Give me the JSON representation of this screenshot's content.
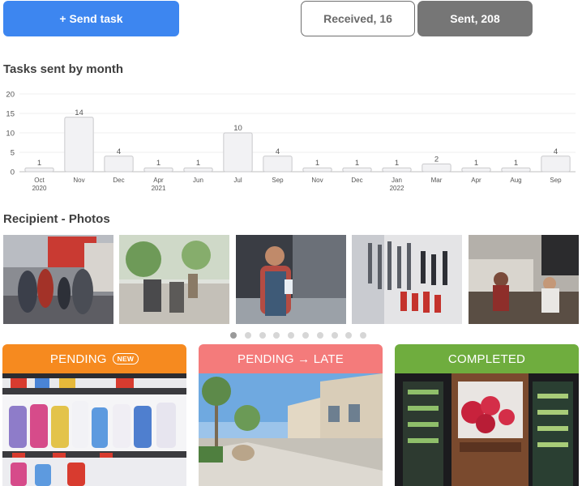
{
  "header": {
    "send_label": "+ Send task",
    "received_label": "Received, 16",
    "sent_label": "Sent, 208"
  },
  "chart_section": {
    "title": "Tasks sent by month"
  },
  "chart_data": {
    "type": "bar",
    "title": "Tasks sent by month",
    "categories": [
      "Oct 2020",
      "Nov",
      "Dec",
      "Apr 2021",
      "Jun",
      "Jul",
      "Sep",
      "Nov",
      "Dec",
      "Jan 2022",
      "Mar",
      "Apr",
      "Aug",
      "Sep"
    ],
    "tick_labels": [
      [
        "Oct",
        "2020"
      ],
      [
        "Nov"
      ],
      [
        "Dec"
      ],
      [
        "Apr",
        "2021"
      ],
      [
        "Jun"
      ],
      [
        "Jul"
      ],
      [
        "Sep"
      ],
      [
        "Nov"
      ],
      [
        "Dec"
      ],
      [
        "Jan",
        "2022"
      ],
      [
        "Mar"
      ],
      [
        "Apr"
      ],
      [
        "Aug"
      ],
      [
        "Sep"
      ]
    ],
    "values": [
      1,
      14,
      4,
      1,
      1,
      10,
      4,
      1,
      1,
      1,
      2,
      1,
      1,
      4
    ],
    "ylim": [
      0,
      20
    ],
    "yticks": [
      0,
      5,
      10,
      15,
      20
    ],
    "grid": true,
    "bar_fill": "#f2f2f4",
    "bar_stroke": "#c9c9cc"
  },
  "photos_section": {
    "title": "Recipient - Photos",
    "photos": [
      {
        "name": "store-entrance-photo"
      },
      {
        "name": "cafe-counter-photo"
      },
      {
        "name": "kitchen-staff-photo"
      },
      {
        "name": "tool-aisle-photo"
      },
      {
        "name": "coffee-shop-photo"
      }
    ],
    "dot_count": 10,
    "active_dot": 0
  },
  "status_cards": [
    {
      "label": "PENDING",
      "badge": "NEW",
      "color": "#f68a1f"
    },
    {
      "label": "PENDING → LATE",
      "badge": "",
      "color": "#f47b7b"
    },
    {
      "label": "COMPLETED",
      "badge": "",
      "color": "#6fad3e"
    }
  ],
  "colors": {
    "primary": "#3d86f0",
    "segment_active": "#767676"
  }
}
